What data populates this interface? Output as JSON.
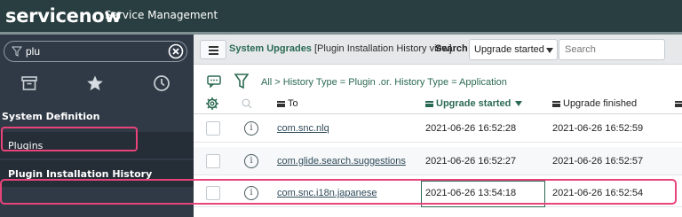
{
  "header": {
    "logo_text": "servicenow",
    "product": "Service Management",
    "bg_color": "#293e40"
  },
  "sidebar": {
    "filter_value": "plu",
    "filter_icon": "funnel-icon",
    "clear_icon": "clear-circle-icon",
    "tab_icons": [
      "archive-icon",
      "star-icon",
      "clock-icon"
    ],
    "section_title": "System Definition",
    "items": [
      {
        "label": "Plugins"
      },
      {
        "label": "Plugin Installation History"
      }
    ]
  },
  "list": {
    "title": "System Upgrades",
    "view": "[Plugin Installation History view]",
    "search_label": "Search",
    "search_field": "Upgrade started",
    "search_placeholder": "Search",
    "breadcrumb": "All > History Type = Plugin .or. History Type = Application",
    "columns": {
      "to": "To",
      "upgrade_started": "Upgrade started",
      "upgrade_finished": "Upgrade finished"
    },
    "rows": [
      {
        "to": "com.snc.nlq",
        "upgrade_started": "2021-06-26 16:52:28",
        "upgrade_finished": "2021-06-26 16:52:59"
      },
      {
        "to": "com.glide.search.suggestions",
        "upgrade_started": "2021-06-26 16:52:27",
        "upgrade_finished": "2021-06-26 16:52:57"
      },
      {
        "to": "com.snc.i18n.japanese",
        "upgrade_started": "2021-06-26 13:54:18",
        "upgrade_finished": "2021-06-26 16:52:54"
      }
    ]
  },
  "colors": {
    "accent": "#2b6a52",
    "highlight": "#e8447a",
    "sidebar": "#303a46"
  }
}
